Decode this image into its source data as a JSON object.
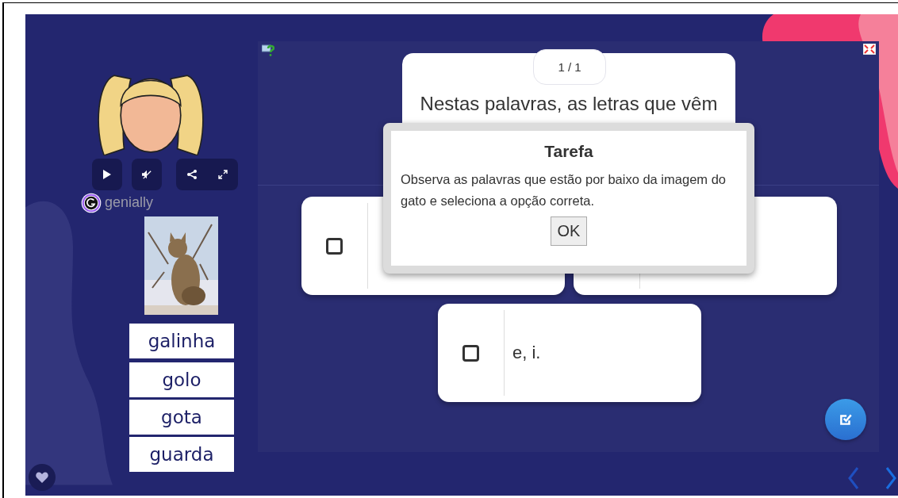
{
  "player": {
    "brand": "genially"
  },
  "slide": {
    "words": [
      "galinha",
      "golo",
      "gota",
      "guarda"
    ]
  },
  "activity": {
    "counter": "1 / 1",
    "question": "Nestas palavras, as letras que vêm",
    "options": [
      {
        "checked": false
      },
      {
        "text": "e, i.",
        "checked": false
      }
    ]
  },
  "dialog": {
    "title": "Tarefa",
    "message": "Observa as palavras que estão por baixo da imagem do gato e seleciona a opção correta.",
    "button": "OK"
  }
}
